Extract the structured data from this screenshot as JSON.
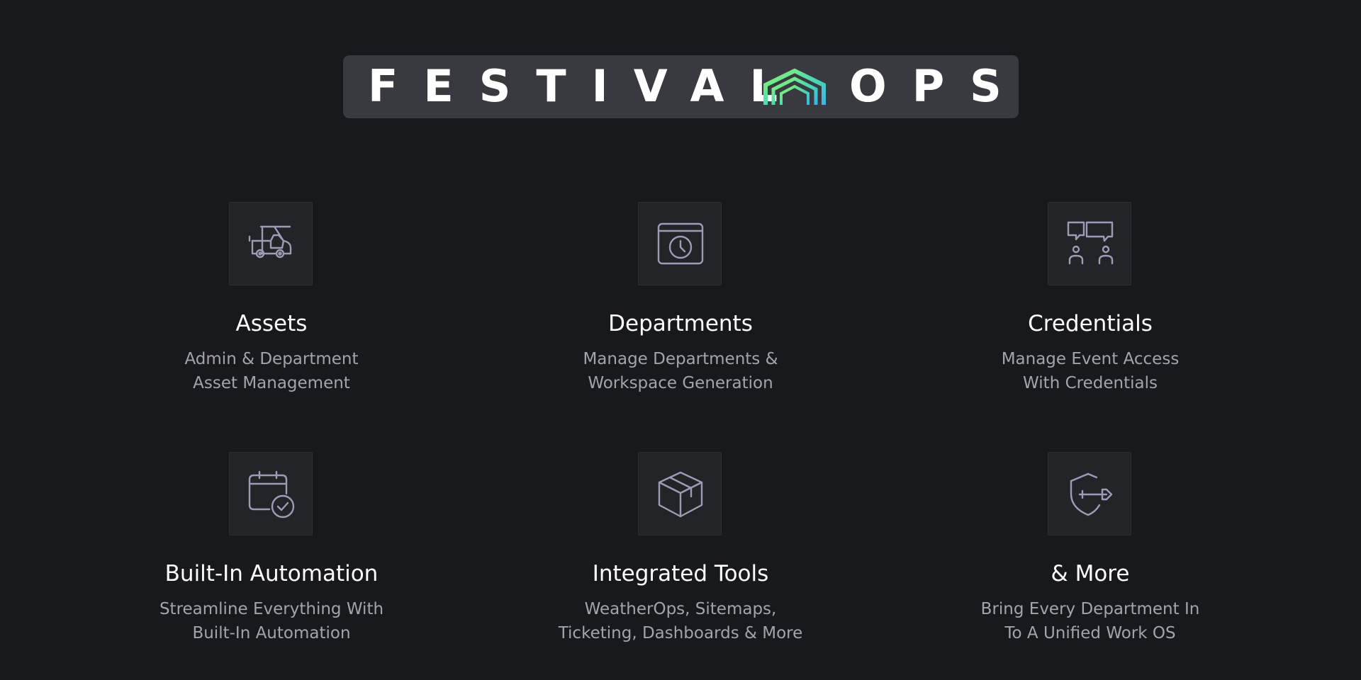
{
  "logo": {
    "word_left": "FESTIVAL",
    "word_right": "OPS",
    "mark_icon": "festival-tent-logo-mark",
    "mark_colors": [
      "#7ef07a",
      "#48d6b4",
      "#38b8e0"
    ]
  },
  "features": [
    {
      "icon": "golf-cart-icon",
      "title": "Assets",
      "desc_line1": "Admin & Department",
      "desc_line2": "Asset Management"
    },
    {
      "icon": "calendar-clock-icon",
      "title": "Departments",
      "desc_line1": "Manage Departments &",
      "desc_line2": "Workspace Generation"
    },
    {
      "icon": "users-chat-icon",
      "title": "Credentials",
      "desc_line1": "Manage Event Access",
      "desc_line2": "With Credentials"
    },
    {
      "icon": "calendar-check-icon",
      "title": "Built-In Automation",
      "desc_line1": "Streamline Everything With",
      "desc_line2": "Built-In Automation"
    },
    {
      "icon": "box-icon",
      "title": "Integrated Tools",
      "desc_line1": "WeatherOps, Sitemaps,",
      "desc_line2": "Ticketing, Dashboards & More"
    },
    {
      "icon": "shield-key-icon",
      "title": "& More",
      "desc_line1": "Bring Every Department In",
      "desc_line2": "To A Unified Work OS"
    }
  ],
  "colors": {
    "background": "#18191d",
    "banner": "#393a40",
    "tile": "#232428",
    "icon_stroke": "#9d9cb6",
    "desc_text": "#a3a4ab"
  }
}
